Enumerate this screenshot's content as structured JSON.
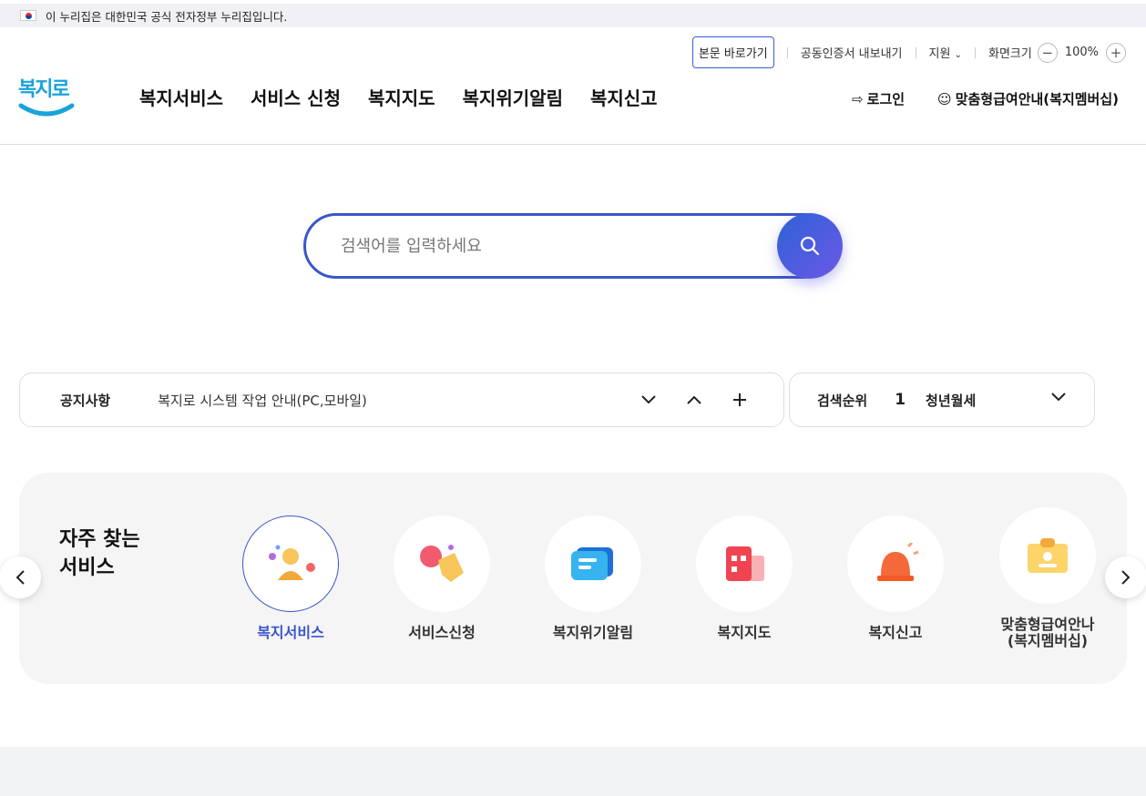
{
  "gov_banner": {
    "text": "이 누리집은 대한민국 공식 전자정부 누리집입니다."
  },
  "utility": {
    "skip_label": "본문 바로가기",
    "cert_label": "공동인증서 내보내기",
    "support_label": "지원",
    "screen_size_label": "화면크기",
    "zoom_minus": "−",
    "zoom_value": "100%",
    "zoom_plus": "+"
  },
  "logo": {
    "text": "복지로"
  },
  "nav": {
    "items": [
      "복지서비스",
      "서비스 신청",
      "복지지도",
      "복지위기알림",
      "복지신고"
    ]
  },
  "account": {
    "login_label": "로그인",
    "member_label": "맞춤형급여안내(복지멤버십)"
  },
  "search": {
    "placeholder": "검색어를 입력하세요"
  },
  "notice": {
    "label": "공지사항",
    "text": "복지로 시스템 작업 안내(PC,모바일)"
  },
  "ranking": {
    "label": "검색순위",
    "rank": "1",
    "keyword": "청년월세"
  },
  "frequent": {
    "title_line1": "자주 찾는",
    "title_line2": "서비스",
    "services": [
      {
        "label": "복지서비스",
        "icon": "person-icon",
        "active": true
      },
      {
        "label": "서비스신청",
        "icon": "hand-pointer-icon"
      },
      {
        "label": "복지위기알림",
        "icon": "message-icon"
      },
      {
        "label": "복지지도",
        "icon": "building-icon"
      },
      {
        "label": "복지신고",
        "icon": "siren-icon"
      },
      {
        "label_line1": "맞춤형급여안나",
        "label_line2": "(복지멤버십)",
        "icon": "id-card-icon"
      }
    ]
  },
  "colors": {
    "accent": "#3a56c8",
    "logo": "#1aa3d9"
  }
}
